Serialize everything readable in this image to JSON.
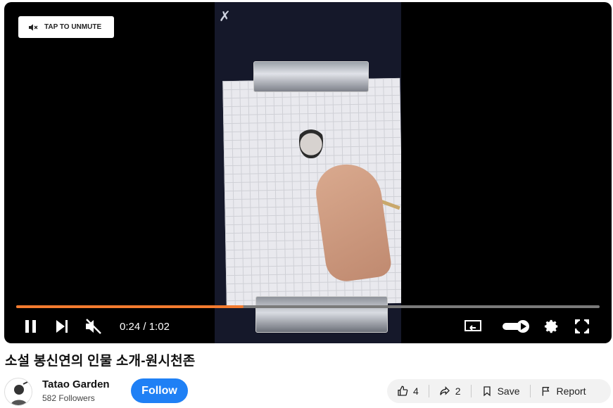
{
  "player": {
    "unmute_label": "TAP TO UNMUTE",
    "time_current": "0:24",
    "time_separator": "/",
    "time_total": "1:02",
    "progress_fraction": 0.39,
    "colors": {
      "progress": "#f37b2f",
      "track": "#7a7a7a"
    },
    "icons": [
      "muted-speaker-icon",
      "pause-icon",
      "next-icon",
      "mute-icon",
      "cast-icon",
      "autoplay-toggle-icon",
      "settings-gear-icon",
      "fullscreen-icon"
    ]
  },
  "video": {
    "title": "소설 봉신연의 인물 소개-원시천존"
  },
  "channel": {
    "name": "Tatao Garden",
    "followers": "582 Followers",
    "follow_label": "Follow",
    "follow_color": "#1f80f5"
  },
  "actions": {
    "like_count": "4",
    "share_count": "2",
    "save_label": "Save",
    "report_label": "Report"
  }
}
